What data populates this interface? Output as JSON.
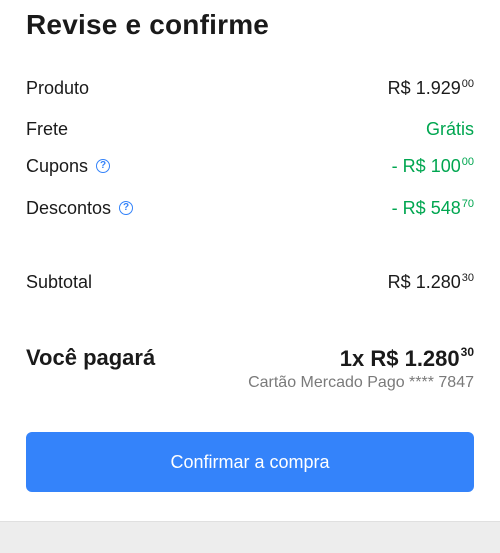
{
  "title": "Revise e confirme",
  "summary": {
    "product": {
      "label": "Produto",
      "currency": "R$",
      "amount": "1.929",
      "cents": "00"
    },
    "shipping": {
      "label": "Frete",
      "value": "Grátis"
    },
    "coupons": {
      "label": "Cupons",
      "sign": "- R$",
      "amount": "100",
      "cents": "00"
    },
    "discounts": {
      "label": "Descontos",
      "sign": "- R$",
      "amount": "548",
      "cents": "70"
    },
    "subtotal": {
      "label": "Subtotal",
      "currency": "R$",
      "amount": "1.280",
      "cents": "30"
    }
  },
  "payment": {
    "label": "Você pagará",
    "installments": "1x R$",
    "amount": "1.280",
    "cents": "30",
    "method": "Cartão Mercado Pago **** 7847"
  },
  "actions": {
    "confirm_label": "Confirmar a compra"
  },
  "icons": {
    "help": "help-circle-icon"
  },
  "colors": {
    "accent": "#3483fa",
    "positive": "#00a650",
    "muted": "#7a7a7a"
  }
}
